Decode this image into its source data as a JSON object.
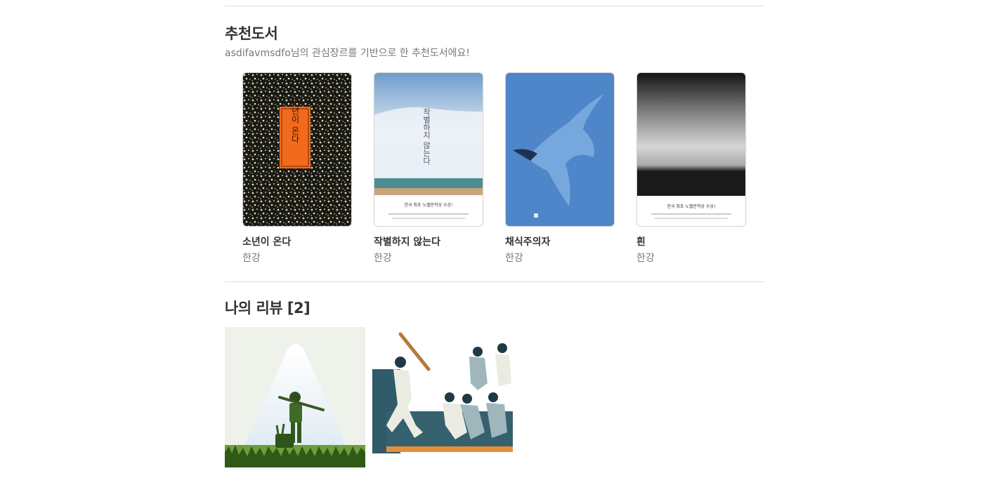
{
  "recommend": {
    "title": "추천도서",
    "subtitle": "asdifavmsdfo님의 관심장르를 기반으로 한 추천도서에요!",
    "books": [
      {
        "title": "소년이 온다",
        "author": "한강",
        "cover_text": "소년이 온다"
      },
      {
        "title": "작별하지 않는다",
        "author": "한강",
        "cover_text": "작별하지 않는다",
        "banner": "한국 최초 노벨문학상 수상!"
      },
      {
        "title": "채식주의자",
        "author": "한강"
      },
      {
        "title": "흰",
        "author": "한강",
        "banner": "한국 최초 노벨문학상 수상!"
      }
    ]
  },
  "reviews": {
    "title": "나의 리뷰 [2]",
    "items": [
      {
        "image": "boy-with-bat-spotlight"
      },
      {
        "image": "baseball-players-dugout"
      }
    ]
  },
  "colors": {
    "divider": "#dcdcdc",
    "heading": "#333333",
    "muted": "#777777",
    "cover1_accent": "#f26a1b",
    "cover3_bg": "#4f86c9"
  }
}
